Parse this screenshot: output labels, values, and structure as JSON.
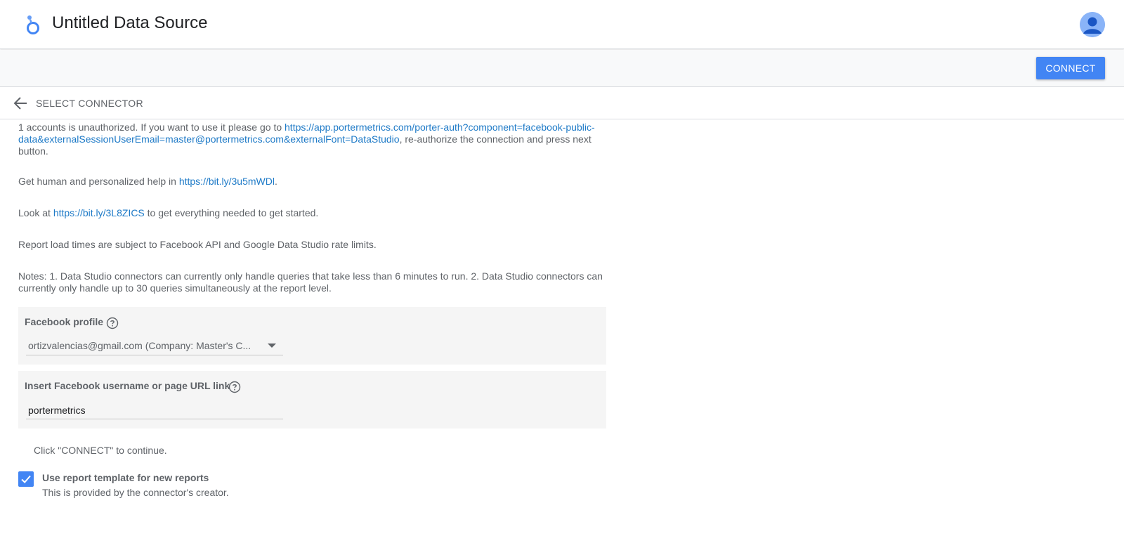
{
  "header": {
    "title": "Untitled Data Source",
    "logo_icon": "looker-studio-logo-icon",
    "avatar_icon": "account-avatar-icon"
  },
  "toolbar": {
    "connect_label": "CONNECT"
  },
  "connector_bar": {
    "back_icon": "arrow-back-icon",
    "label": "SELECT CONNECTOR"
  },
  "messages": {
    "unauthorized_prefix": "1 accounts is unauthorized. If you want to use it please go to ",
    "unauthorized_link": "https://app.portermetrics.com/porter-auth?component=facebook-public-data&externalSessionUserEmail=master@portermetrics.com&externalFont=DataStudio",
    "unauthorized_suffix": ", re-authorize the connection and press next button.",
    "help_prefix": "Get human and personalized help in ",
    "help_link": "https://bit.ly/3u5mWDl",
    "help_suffix": ".",
    "look_prefix": "Look at ",
    "look_link": "https://bit.ly/3L8ZICS",
    "look_suffix": " to get everything needed to get started.",
    "rate_limits": "Report load times are subject to Facebook API and Google Data Studio rate limits.",
    "notes": "Notes: 1. Data Studio connectors can currently only handle queries that take less than 6 minutes to run. 2. Data Studio connectors can currently only handle up to 30 queries simultaneously at the report level."
  },
  "facebook_profile": {
    "label": "Facebook profile",
    "selected_value": "ortizvalencias@gmail.com (Company: Master's C...",
    "help_icon": "help-circle-icon"
  },
  "facebook_username": {
    "label": "Insert Facebook username or page URL link",
    "value": "portermetrics",
    "help_icon": "help-circle-icon"
  },
  "continue_text": "Click \"CONNECT\" to continue.",
  "template_option": {
    "checked": true,
    "label": "Use report template for new reports",
    "sublabel": "This is provided by the connector's creator."
  },
  "colors": {
    "accent": "#4285f4",
    "link": "#1e7ac7",
    "panel_bg": "#f5f5f5"
  }
}
